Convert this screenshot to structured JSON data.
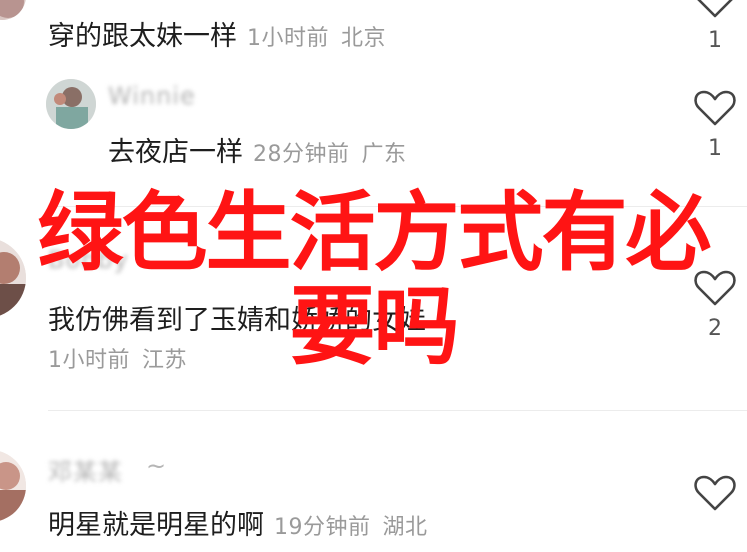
{
  "comments": [
    {
      "text": "穿的跟太妹一样",
      "time": "1小时前",
      "location": "北京",
      "likes": "1"
    },
    {
      "username": "Winnie",
      "text": "去夜店一样",
      "time": "28分钟前",
      "location": "广东",
      "likes": "1"
    },
    {
      "username": "Bobby",
      "text": "我仿佛看到了玉婧和娇娇的女娃",
      "time": "1小时前",
      "location": "江苏",
      "likes": "2"
    },
    {
      "username": "邓某某",
      "username_suffix": "~",
      "text": "明星就是明星的啊",
      "time": "19分钟前",
      "location": "湖北"
    }
  ],
  "overlay": {
    "line1": "绿色生活方式有必",
    "line2": "要吗"
  },
  "colors": {
    "overlay_text": "#ff1414",
    "meta_text": "#9a9a9a",
    "body_text": "#1e1e1e"
  }
}
